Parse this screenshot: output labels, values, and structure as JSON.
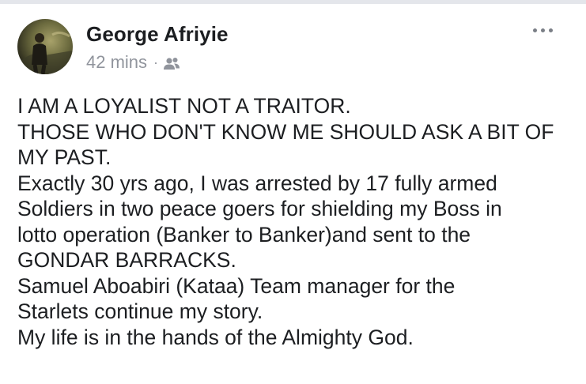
{
  "post": {
    "author_name": "George Afriyie",
    "timestamp": "42 mins",
    "separator": "·",
    "audience_icon": "friends-icon",
    "more_icon": "more-options-icon",
    "lines": [
      "I AM A LOYALIST NOT A TRAITOR.",
      "THOSE WHO DON'T KNOW ME SHOULD ASK A BIT OF",
      "MY PAST.",
      "Exactly 30 yrs ago, I was arrested by 17 fully armed",
      "Soldiers in two peace goers for shielding my Boss in",
      "lotto operation (Banker to Banker)and sent to the",
      "GONDAR BARRACKS.",
      "Samuel Aboabiri (Kataa) Team manager for the",
      "Starlets continue my story.",
      "My life is in the hands of the Almighty God."
    ]
  },
  "colors": {
    "text": "#1c1e21",
    "meta": "#90949c",
    "divider": "#e4e6eb"
  }
}
